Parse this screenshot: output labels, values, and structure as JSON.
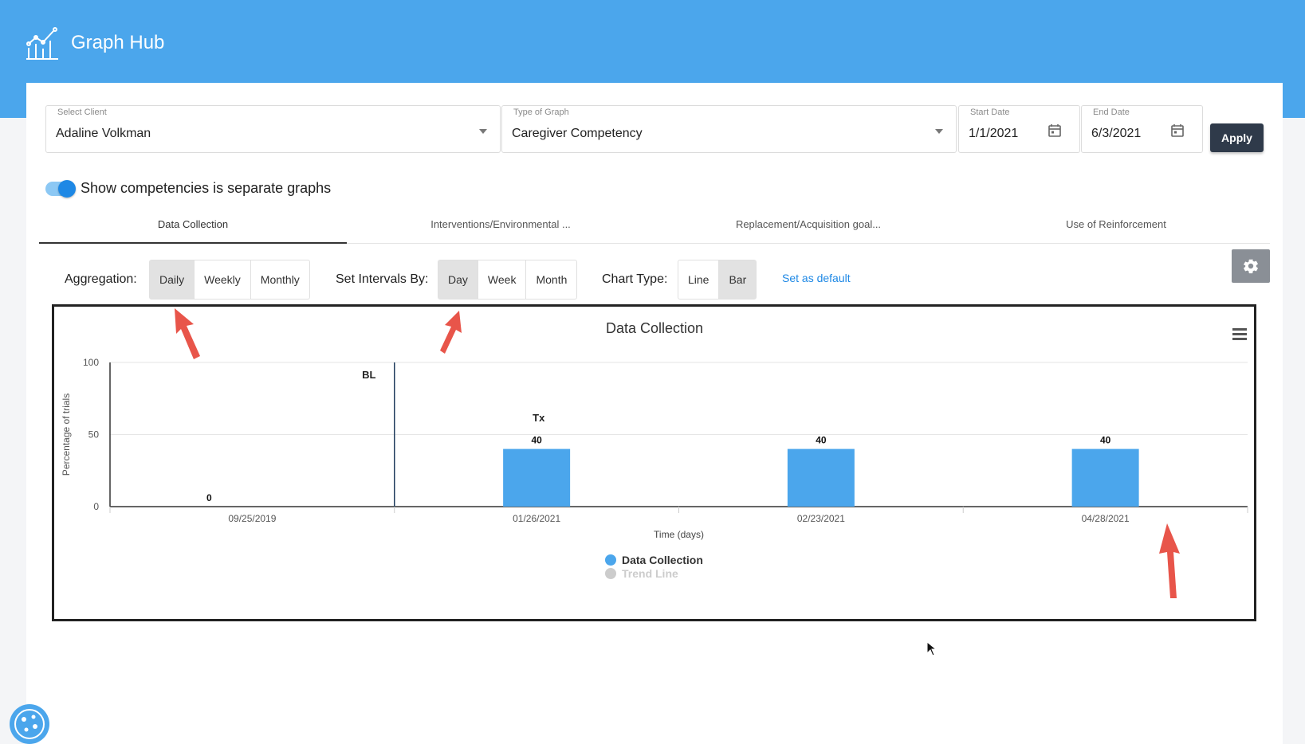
{
  "app": {
    "title": "Graph Hub"
  },
  "filters": {
    "client": {
      "label": "Select Client",
      "value": "Adaline Volkman"
    },
    "graph_type": {
      "label": "Type of Graph",
      "value": "Caregiver Competency"
    },
    "start_date": {
      "label": "Start Date",
      "value": "1/1/2021"
    },
    "end_date": {
      "label": "End Date",
      "value": "6/3/2021"
    },
    "apply_label": "Apply"
  },
  "toggle": {
    "label": "Show competencies is separate graphs",
    "on": true
  },
  "tabs": [
    {
      "label": "Data Collection",
      "active": true
    },
    {
      "label": "Interventions/Environmental ...",
      "active": false
    },
    {
      "label": "Replacement/Acquisition goal...",
      "active": false
    },
    {
      "label": "Use of Reinforcement",
      "active": false
    }
  ],
  "controls": {
    "aggregation": {
      "label": "Aggregation:",
      "options": [
        "Daily",
        "Weekly",
        "Monthly"
      ],
      "selected": "Daily"
    },
    "intervals": {
      "label": "Set Intervals By:",
      "options": [
        "Day",
        "Week",
        "Month"
      ],
      "selected": "Day"
    },
    "chart_type": {
      "label": "Chart Type:",
      "options": [
        "Line",
        "Bar"
      ],
      "selected": "Bar"
    },
    "set_default": "Set as default"
  },
  "colors": {
    "header": "#4ba6ec",
    "bar": "#4ba6ec",
    "apply": "#2f3a4a",
    "arrow": "#e8554a"
  },
  "chart_data": {
    "type": "bar",
    "title": "Data Collection",
    "xlabel": "Time (days)",
    "ylabel": "Percentage of trials",
    "ylim": [
      0,
      100
    ],
    "yticks": [
      0,
      50,
      100
    ],
    "categories": [
      "09/25/2019",
      "01/26/2021",
      "02/23/2021",
      "04/28/2021"
    ],
    "series": [
      {
        "name": "Data Collection",
        "values": [
          0,
          40,
          40,
          40
        ]
      },
      {
        "name": "Trend Line",
        "values": [],
        "hidden": true
      }
    ],
    "phase_lines": [
      {
        "after_category": 0,
        "labels": [
          "BL",
          "Tx"
        ]
      }
    ],
    "legend": "bottom-center",
    "grid": true
  }
}
